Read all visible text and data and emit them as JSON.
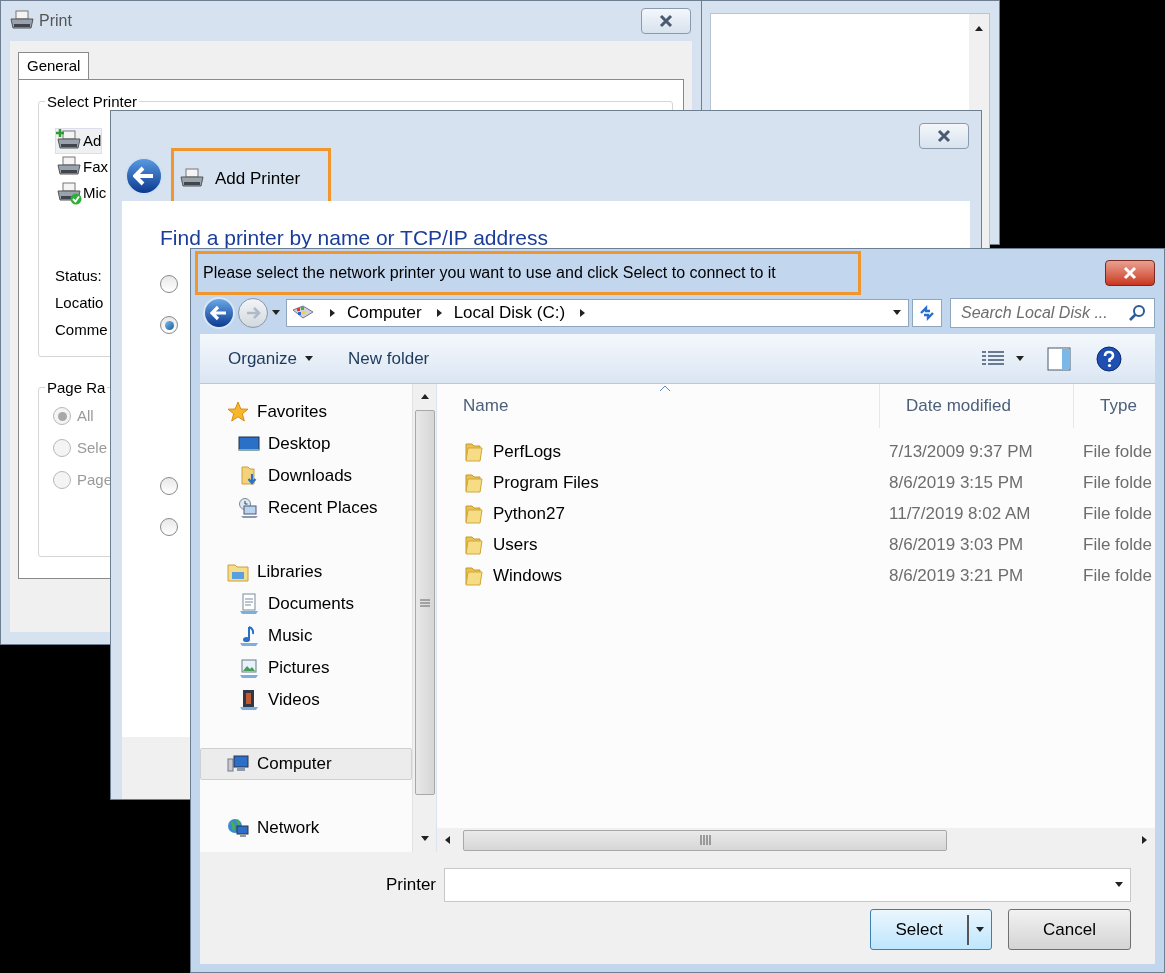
{
  "print_dialog": {
    "title": "Print",
    "tabs": [
      {
        "label": "General",
        "selected": true
      }
    ],
    "select_printer": {
      "label": "Select Printer",
      "printers": [
        {
          "name": "Ad",
          "kind": "add",
          "selected": true
        },
        {
          "name": "Fax",
          "kind": "fax",
          "selected": false
        },
        {
          "name": "Mic",
          "kind": "default",
          "selected": false
        }
      ]
    },
    "details": [
      "Status:",
      "Locatio",
      "Comme"
    ],
    "page_range": {
      "label": "Page Ra",
      "options": [
        {
          "label": "All",
          "selected": true,
          "disabled": true
        },
        {
          "label": "Sele",
          "selected": false,
          "disabled": true
        },
        {
          "label": "Page",
          "selected": false,
          "disabled": true
        }
      ]
    }
  },
  "add_printer": {
    "header": "Add Printer",
    "heading": "Find a printer by name or TCP/IP address",
    "options": [
      {
        "selected": false
      },
      {
        "selected": true
      },
      {
        "selected": false
      },
      {
        "selected": false
      }
    ]
  },
  "file_dialog": {
    "title": "Please select the network printer you want to use and click Select to connect to it",
    "breadcrumb": [
      "Computer",
      "Local Disk (C:)"
    ],
    "search": {
      "placeholder": "Search Local Disk ..."
    },
    "toolbar": [
      {
        "label": "Organize",
        "kind": "menu"
      },
      {
        "label": "New folder",
        "kind": "button"
      }
    ],
    "nav": [
      {
        "label": "Favorites",
        "kind": "star",
        "selected": false,
        "children": [
          {
            "label": "Desktop",
            "kind": "desktop",
            "selected": false
          },
          {
            "label": "Downloads",
            "kind": "downloads",
            "selected": false
          },
          {
            "label": "Recent Places",
            "kind": "recent",
            "selected": false
          }
        ]
      },
      {
        "label": "Libraries",
        "kind": "libraries",
        "selected": false,
        "children": [
          {
            "label": "Documents",
            "kind": "documents",
            "selected": false
          },
          {
            "label": "Music",
            "kind": "music",
            "selected": false
          },
          {
            "label": "Pictures",
            "kind": "pictures",
            "selected": false
          },
          {
            "label": "Videos",
            "kind": "videos",
            "selected": false
          }
        ]
      },
      {
        "label": "Computer",
        "kind": "computer",
        "selected": true
      },
      {
        "label": "Network",
        "kind": "network",
        "selected": false
      }
    ],
    "columns": [
      "Name",
      "Date modified",
      "Type"
    ],
    "rows": [
      {
        "name": "PerfLogs",
        "date": "7/13/2009 9:37 PM",
        "type": "File folde"
      },
      {
        "name": "Program Files",
        "date": "8/6/2019 3:15 PM",
        "type": "File folde"
      },
      {
        "name": "Python27",
        "date": "11/7/2019 8:02 AM",
        "type": "File folde"
      },
      {
        "name": "Users",
        "date": "8/6/2019 3:03 PM",
        "type": "File folde"
      },
      {
        "name": "Windows",
        "date": "8/6/2019 3:21 PM",
        "type": "File folde"
      }
    ],
    "printer_field": {
      "label": "Printer"
    },
    "buttons": [
      {
        "label": "Select",
        "kind": "split"
      },
      {
        "label": "Cancel",
        "kind": "plain"
      }
    ]
  }
}
